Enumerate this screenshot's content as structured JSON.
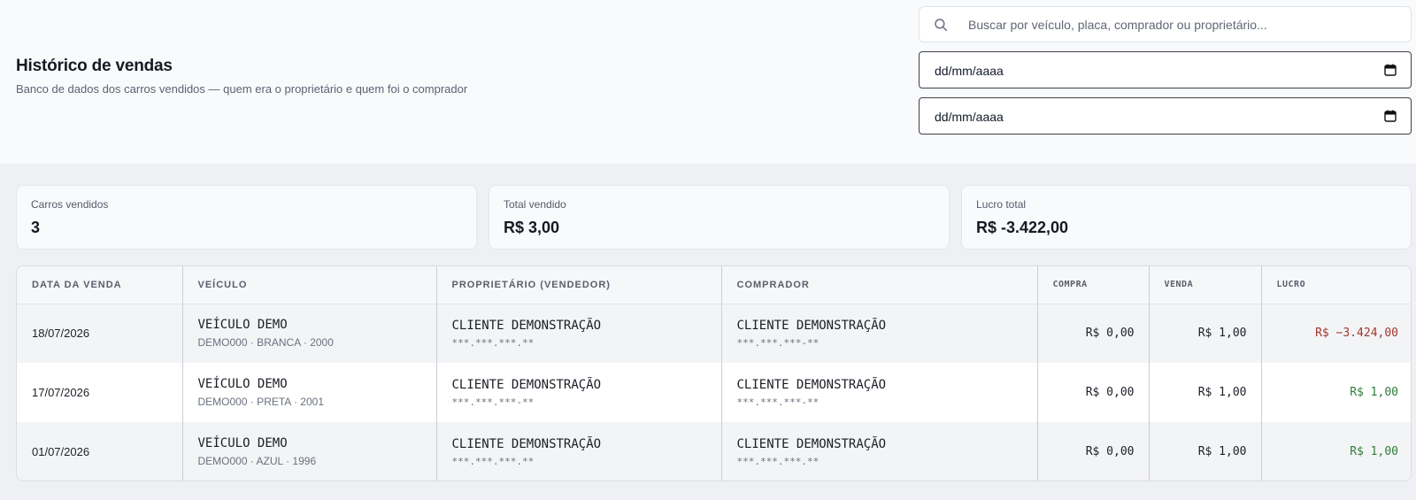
{
  "header": {
    "title": "Histórico de vendas",
    "subtitle": "Banco de dados dos carros vendidos — quem era o proprietário e quem foi o comprador"
  },
  "search": {
    "placeholder": "Buscar por veículo, placa, comprador ou proprietário..."
  },
  "filters": {
    "date_start": "dd/mm/aaaa",
    "date_end": "dd/mm/aaaa"
  },
  "stats": [
    {
      "label": "Carros vendidos",
      "value": "3"
    },
    {
      "label": "Total vendido",
      "value": "R$ 3,00"
    },
    {
      "label": "Lucro total",
      "value": "R$ -3.422,00"
    }
  ],
  "table": {
    "columns": [
      "DATA DA VENDA",
      "VEÍCULO",
      "PROPRIETÁRIO (VENDEDOR)",
      "COMPRADOR",
      "COMPRA",
      "VENDA",
      "LUCRO"
    ],
    "rows": [
      {
        "date": "18/07/2026",
        "vehicle": "VEÍCULO DEMO",
        "vehicle_info": "DEMO000 · BRANCA · 2000",
        "owner": "CLIENTE DEMONSTRAÇÃO",
        "owner_doc": "***.***.***.**",
        "buyer": "CLIENTE DEMONSTRAÇÃO",
        "buyer_doc": "***.***.***-**",
        "purchase": "R$ 0,00",
        "sale": "R$ 1,00",
        "profit": "R$ −3.424,00",
        "profit_status": "negative"
      },
      {
        "date": "17/07/2026",
        "vehicle": "VEÍCULO DEMO",
        "vehicle_info": "DEMO000 · PRETA · 2001",
        "owner": "CLIENTE DEMONSTRAÇÃO",
        "owner_doc": "***.***.***-**",
        "buyer": "CLIENTE DEMONSTRAÇÃO",
        "buyer_doc": "***.***.***-**",
        "purchase": "R$ 0,00",
        "sale": "R$ 1,00",
        "profit": "R$ 1,00",
        "profit_status": "positive"
      },
      {
        "date": "01/07/2026",
        "vehicle": "VEÍCULO DEMO",
        "vehicle_info": "DEMO000 · AZUL · 1996",
        "owner": "CLIENTE DEMONSTRAÇÃO",
        "owner_doc": "***.***.***.**",
        "buyer": "CLIENTE DEMONSTRAÇÃO",
        "buyer_doc": "***.***.***.**",
        "purchase": "R$ 0,00",
        "sale": "R$ 1,00",
        "profit": "R$ 1,00",
        "profit_status": "positive"
      }
    ]
  },
  "colors": {
    "negative": "#a3362b",
    "positive": "#2f7d3a"
  },
  "icons": {
    "search": "search-icon",
    "calendar": "calendar-icon"
  }
}
